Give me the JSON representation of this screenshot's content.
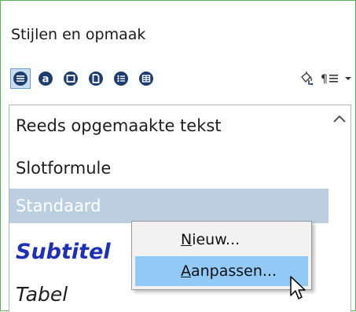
{
  "panel": {
    "title": "Stijlen en opmaak"
  },
  "toolbar": {
    "buttons": [
      {
        "icon": "paragraph-styles-icon",
        "active": true
      },
      {
        "icon": "character-styles-icon",
        "active": false
      },
      {
        "icon": "frame-styles-icon",
        "active": false
      },
      {
        "icon": "page-styles-icon",
        "active": false
      },
      {
        "icon": "list-styles-icon",
        "active": false
      },
      {
        "icon": "table-styles-icon",
        "active": false
      }
    ],
    "fill_format_icon": "fill-format-mode-icon",
    "new_style_icon": "new-style-from-selection-icon",
    "dropdown_icon": "chevron-down-icon"
  },
  "styles_list": {
    "items": [
      {
        "label": "Reeds opgemaakte tekst",
        "selected": false
      },
      {
        "label": "Slotformule",
        "selected": false
      },
      {
        "label": "Standaard",
        "selected": true
      },
      {
        "label": "Subtitel",
        "selected": false
      },
      {
        "label": "Tabel",
        "selected": false
      }
    ]
  },
  "context_menu": {
    "items": [
      {
        "accel": "N",
        "rest": "ieuw...",
        "hover": false
      },
      {
        "accel": "A",
        "rest": "anpassen...",
        "hover": true
      }
    ]
  },
  "colors": {
    "selected_row": "#bccfe0",
    "menu_hover": "#91c9f7",
    "active_button": "#c9def2",
    "subtitle_text": "#1e2fb8",
    "panel_border": "#58b058"
  }
}
